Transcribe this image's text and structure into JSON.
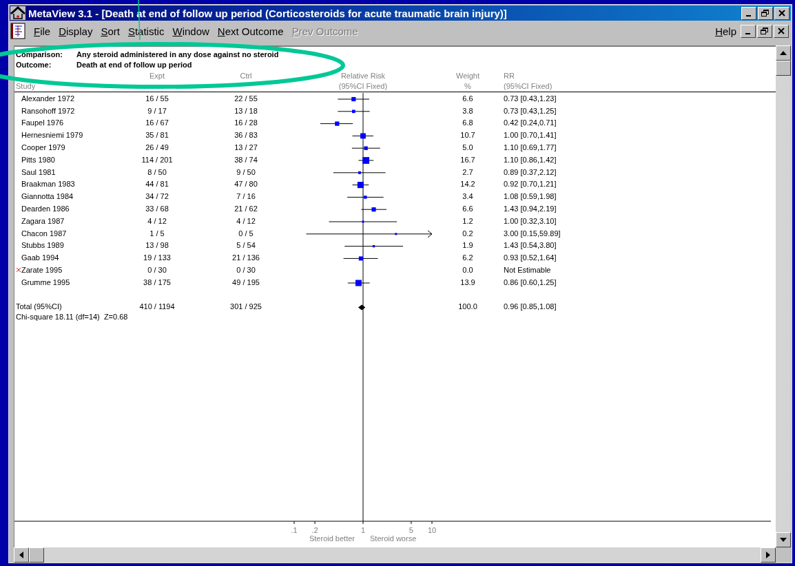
{
  "window": {
    "title": "MetaView 3.1 - [Death at end of follow up period (Corticosteroids for acute traumatic brain injury)]"
  },
  "menu": [
    {
      "label": "File",
      "disabled": false
    },
    {
      "label": "Display",
      "disabled": false
    },
    {
      "label": "Sort",
      "disabled": false
    },
    {
      "label": "Statistic",
      "disabled": false
    },
    {
      "label": "Window",
      "disabled": false
    },
    {
      "label": "Next Outcome",
      "disabled": false
    },
    {
      "label": "Prev Outcome",
      "disabled": true
    }
  ],
  "help_menu": {
    "label": "Help"
  },
  "header": {
    "comparison_label": "Comparison:",
    "comparison": "Any steroid administered in any dose against no steroid",
    "outcome_label": "Outcome:",
    "outcome": "Death at end of follow up period"
  },
  "column_headers": {
    "study": "Study",
    "expt": "Expt",
    "ctrl": "Ctrl",
    "relative_risk": "Relative Risk",
    "relative_risk_sub": "(95%CI Fixed)",
    "weight": "Weight",
    "weight_sub": "%",
    "rr": "RR",
    "rr_sub": "(95%CI Fixed)"
  },
  "rows": [
    {
      "study": "Alexander 1972",
      "expt": "16 / 55",
      "ctrl": "22 / 55",
      "weight": "6.6",
      "rr": "0.73 [0.43,1.23]",
      "excluded": false
    },
    {
      "study": "Ransohoff 1972",
      "expt": "9 / 17",
      "ctrl": "13 / 18",
      "weight": "3.8",
      "rr": "0.73 [0.43,1.25]",
      "excluded": false
    },
    {
      "study": "Faupel 1976",
      "expt": "16 / 67",
      "ctrl": "16 / 28",
      "weight": "6.8",
      "rr": "0.42 [0.24,0.71]",
      "excluded": false
    },
    {
      "study": "Hernesniemi 1979",
      "expt": "35 / 81",
      "ctrl": "36 / 83",
      "weight": "10.7",
      "rr": "1.00 [0.70,1.41]",
      "excluded": false
    },
    {
      "study": "Cooper 1979",
      "expt": "26 / 49",
      "ctrl": "13 / 27",
      "weight": "5.0",
      "rr": "1.10 [0.69,1.77]",
      "excluded": false
    },
    {
      "study": "Pitts 1980",
      "expt": "114 / 201",
      "ctrl": "38 / 74",
      "weight": "16.7",
      "rr": "1.10 [0.86,1.42]",
      "excluded": false
    },
    {
      "study": "Saul 1981",
      "expt": "8 / 50",
      "ctrl": "9 / 50",
      "weight": "2.7",
      "rr": "0.89 [0.37,2.12]",
      "excluded": false
    },
    {
      "study": "Braakman 1983",
      "expt": "44 / 81",
      "ctrl": "47 / 80",
      "weight": "14.2",
      "rr": "0.92 [0.70,1.21]",
      "excluded": false
    },
    {
      "study": "Giannotta 1984",
      "expt": "34 / 72",
      "ctrl": "7 / 16",
      "weight": "3.4",
      "rr": "1.08 [0.59,1.98]",
      "excluded": false
    },
    {
      "study": "Dearden 1986",
      "expt": "33 / 68",
      "ctrl": "21 / 62",
      "weight": "6.6",
      "rr": "1.43 [0.94,2.19]",
      "excluded": false
    },
    {
      "study": "Zagara 1987",
      "expt": "4 / 12",
      "ctrl": "4 / 12",
      "weight": "1.2",
      "rr": "1.00 [0.32,3.10]",
      "excluded": false
    },
    {
      "study": "Chacon 1987",
      "expt": "1 / 5",
      "ctrl": "0 / 5",
      "weight": "0.2",
      "rr": "3.00 [0.15,59.89]",
      "excluded": false
    },
    {
      "study": "Stubbs 1989",
      "expt": "13 / 98",
      "ctrl": "5 / 54",
      "weight": "1.9",
      "rr": "1.43 [0.54,3.80]",
      "excluded": false
    },
    {
      "study": "Gaab 1994",
      "expt": "19 / 133",
      "ctrl": "21 / 136",
      "weight": "6.2",
      "rr": "0.93 [0.52,1.64]",
      "excluded": false
    },
    {
      "study": "Zarate 1995",
      "expt": "0 / 30",
      "ctrl": "0 / 30",
      "weight": "0.0",
      "rr": "Not Estimable",
      "excluded": true
    },
    {
      "study": "Grumme 1995",
      "expt": "38 / 175",
      "ctrl": "49 / 195",
      "weight": "13.9",
      "rr": "0.86 [0.60,1.25]",
      "excluded": false
    }
  ],
  "total": {
    "study": "Total (95%CI)",
    "expt": "410 / 1194",
    "ctrl": "301 / 925",
    "weight": "100.0",
    "rr": "0.96 [0.85,1.08]"
  },
  "heterogeneity": "Chi-square 18.11 (df=14)  Z=0.68",
  "forest_plot": {
    "ticks": [
      ".1",
      ".2",
      "1",
      "5",
      "10"
    ],
    "captions": [
      "Steroid better",
      "Steroid worse"
    ]
  }
}
